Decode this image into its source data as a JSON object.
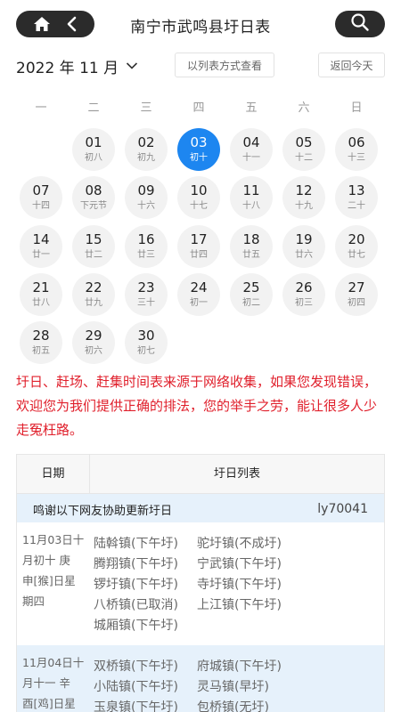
{
  "header": {
    "title": "南宁市武鸣县圩日表"
  },
  "toolbar": {
    "month": "2022 年 11 月",
    "list_view_label": "以列表方式查看",
    "today_label": "返回今天"
  },
  "weekdays": [
    "一",
    "二",
    "三",
    "四",
    "五",
    "六",
    "日"
  ],
  "calendar": {
    "days": [
      {
        "num": "01",
        "lunar": "初八"
      },
      {
        "num": "02",
        "lunar": "初九"
      },
      {
        "num": "03",
        "lunar": "初十",
        "selected": true
      },
      {
        "num": "04",
        "lunar": "十一"
      },
      {
        "num": "05",
        "lunar": "十二"
      },
      {
        "num": "06",
        "lunar": "十三"
      },
      {
        "num": "07",
        "lunar": "十四"
      },
      {
        "num": "08",
        "lunar": "下元节"
      },
      {
        "num": "09",
        "lunar": "十六"
      },
      {
        "num": "10",
        "lunar": "十七"
      },
      {
        "num": "11",
        "lunar": "十八"
      },
      {
        "num": "12",
        "lunar": "十九"
      },
      {
        "num": "13",
        "lunar": "二十"
      },
      {
        "num": "14",
        "lunar": "廿一"
      },
      {
        "num": "15",
        "lunar": "廿二"
      },
      {
        "num": "16",
        "lunar": "廿三"
      },
      {
        "num": "17",
        "lunar": "廿四"
      },
      {
        "num": "18",
        "lunar": "廿五"
      },
      {
        "num": "19",
        "lunar": "廿六"
      },
      {
        "num": "20",
        "lunar": "廿七"
      },
      {
        "num": "21",
        "lunar": "廿八"
      },
      {
        "num": "22",
        "lunar": "廿九"
      },
      {
        "num": "23",
        "lunar": "三十"
      },
      {
        "num": "24",
        "lunar": "初一"
      },
      {
        "num": "25",
        "lunar": "初二"
      },
      {
        "num": "26",
        "lunar": "初三"
      },
      {
        "num": "27",
        "lunar": "初四"
      },
      {
        "num": "28",
        "lunar": "初五"
      },
      {
        "num": "29",
        "lunar": "初六"
      },
      {
        "num": "30",
        "lunar": "初七"
      }
    ]
  },
  "notice": "圩日、赶场、赶集时间表来源于网络收集，如果您发现错误，欢迎您为我们提供正确的排法，您的举手之劳，能让很多人少走冤枉路。",
  "table": {
    "col_date": "日期",
    "col_list": "圩日列表",
    "thanks_label": "鸣谢以下网友协助更新圩日",
    "thanks_user": "ly70041",
    "rows": [
      {
        "date_lines": [
          "11月03日十",
          "月初十 庚",
          "申[猴]日星",
          "期四"
        ],
        "markets": [
          "陆斡镇(下午圩)",
          "驼圩镇(不成圩)",
          "腾翔镇(下午圩)",
          "宁武镇(下午圩)",
          "锣圩镇(下午圩)",
          "寺圩镇(下午圩)",
          "八桥镇(已取消)",
          "上江镇(下午圩)",
          "城厢镇(下午圩)"
        ]
      },
      {
        "date_lines": [
          "11月04日十",
          "月十一 辛",
          "酉[鸡]日星"
        ],
        "markets": [
          "双桥镇(下午圩)",
          "府城镇(下午圩)",
          "小陆镇(下午圩)",
          "灵马镇(早圩)",
          "玉泉镇(下午圩)",
          "包桥镇(无圩)"
        ]
      }
    ]
  },
  "colors": {
    "accent": "#1d86f0",
    "notice": "#e0202c",
    "dark_pill": "#2b2b2b"
  }
}
